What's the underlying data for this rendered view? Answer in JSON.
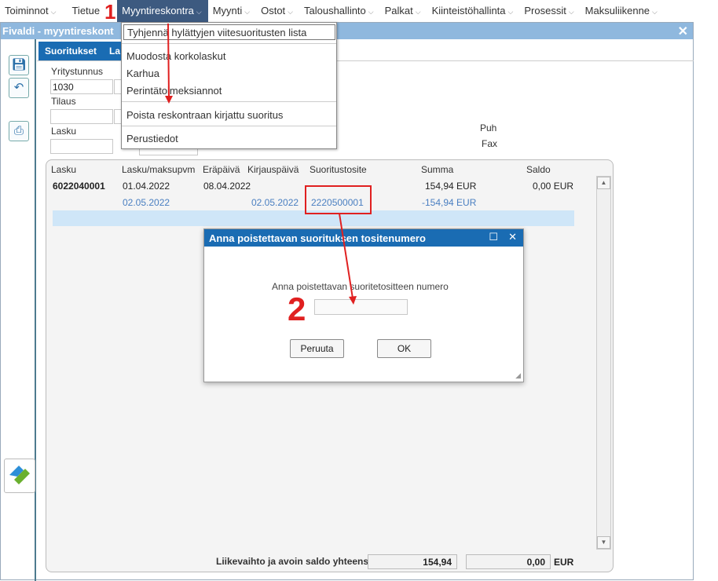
{
  "menu": {
    "items": [
      "Toiminnot",
      "Tietue",
      "Myyntireskontra",
      "Myynti",
      "Ostot",
      "Taloushallinto",
      "Palkat",
      "Kiinteistöhallinta",
      "Prosessit",
      "Maksuliikenne"
    ],
    "active": "Myyntireskontra"
  },
  "dropdown": {
    "items": [
      "Tyhjennä hylättyjen viitesuoritusten lista",
      "Muodosta korkolaskut",
      "Karhua",
      "Perintätoimeksiannot",
      "Poista reskontraan kirjattu suoritus",
      "Perustiedot"
    ]
  },
  "window": {
    "title": "Fivaldi - myyntireskont",
    "tabs": [
      "Suoritukset",
      "La"
    ]
  },
  "form": {
    "yritystunnus_label": "Yritystunnus",
    "yritystunnus_value": "1030",
    "tilaus_label": "Tilaus",
    "lasku_label": "Lasku",
    "puh_label": "Puh",
    "fax_label": "Fax"
  },
  "grid": {
    "headers": [
      "Lasku",
      "Lasku/maksupvm",
      "Eräpäivä",
      "Kirjauspäivä",
      "Suoritustosite",
      "Summa",
      "Saldo"
    ],
    "rows": [
      {
        "lasku": "6022040001",
        "pvm": "01.04.2022",
        "erapaiva": "08.04.2022",
        "kirjauspaiva": "",
        "tosite": "",
        "summa": "154,94 EUR",
        "saldo": "0,00 EUR"
      },
      {
        "lasku": "",
        "pvm": "02.05.2022",
        "erapaiva": "",
        "kirjauspaiva": "02.05.2022",
        "tosite": "2220500001",
        "summa": "-154,94 EUR",
        "saldo": ""
      }
    ],
    "total_label": "Liikevaihto ja avoin saldo yhteensä",
    "total_liikevaihto": "154,94",
    "total_saldo": "0,00",
    "currency": "EUR"
  },
  "dialog": {
    "title": "Anna poistettavan suorituksen tositenumero",
    "prompt": "Anna poistettavan suoritetositteen numero",
    "input_value": "",
    "cancel": "Peruuta",
    "ok": "OK"
  },
  "annotations": {
    "step1": "1",
    "step2": "2",
    "color": "#e02020"
  }
}
